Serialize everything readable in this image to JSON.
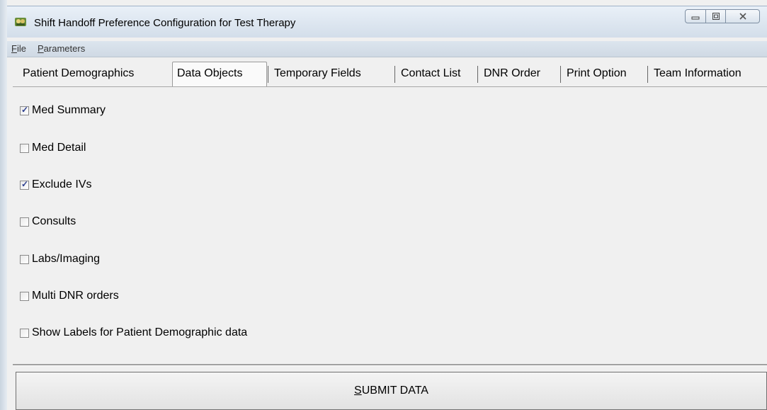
{
  "window": {
    "title": "Shift Handoff Preference Configuration for  Test Therapy",
    "icon": "handoff-app-icon",
    "controls": {
      "minimize": "minimize-icon",
      "maximize": "maximize-icon",
      "close": "close-icon"
    }
  },
  "menu": [
    {
      "label": "File",
      "access_key": "F",
      "rest": "ile"
    },
    {
      "label": "Parameters",
      "access_key": "P",
      "rest": "arameters"
    }
  ],
  "tabs": [
    {
      "label": "Patient Demographics",
      "active": false
    },
    {
      "label": "Data Objects",
      "active": true
    },
    {
      "label": "Temporary Fields",
      "active": false
    },
    {
      "label": "Contact List",
      "active": false
    },
    {
      "label": "DNR Order",
      "active": false
    },
    {
      "label": "Print Option",
      "active": false
    },
    {
      "label": "Team Information",
      "active": false
    }
  ],
  "options": [
    {
      "label": "Med Summary",
      "checked": true
    },
    {
      "label": "Med Detail",
      "checked": false
    },
    {
      "label": "Exclude IVs",
      "checked": true
    },
    {
      "label": "Consults",
      "checked": false
    },
    {
      "label": "Labs/Imaging",
      "checked": false
    },
    {
      "label": "Multi DNR orders",
      "checked": false
    },
    {
      "label": "Show Labels for Patient Demographic data",
      "checked": false
    }
  ],
  "submit": {
    "access_key": "S",
    "rest": "UBMIT DATA",
    "label": "SUBMIT DATA"
  }
}
